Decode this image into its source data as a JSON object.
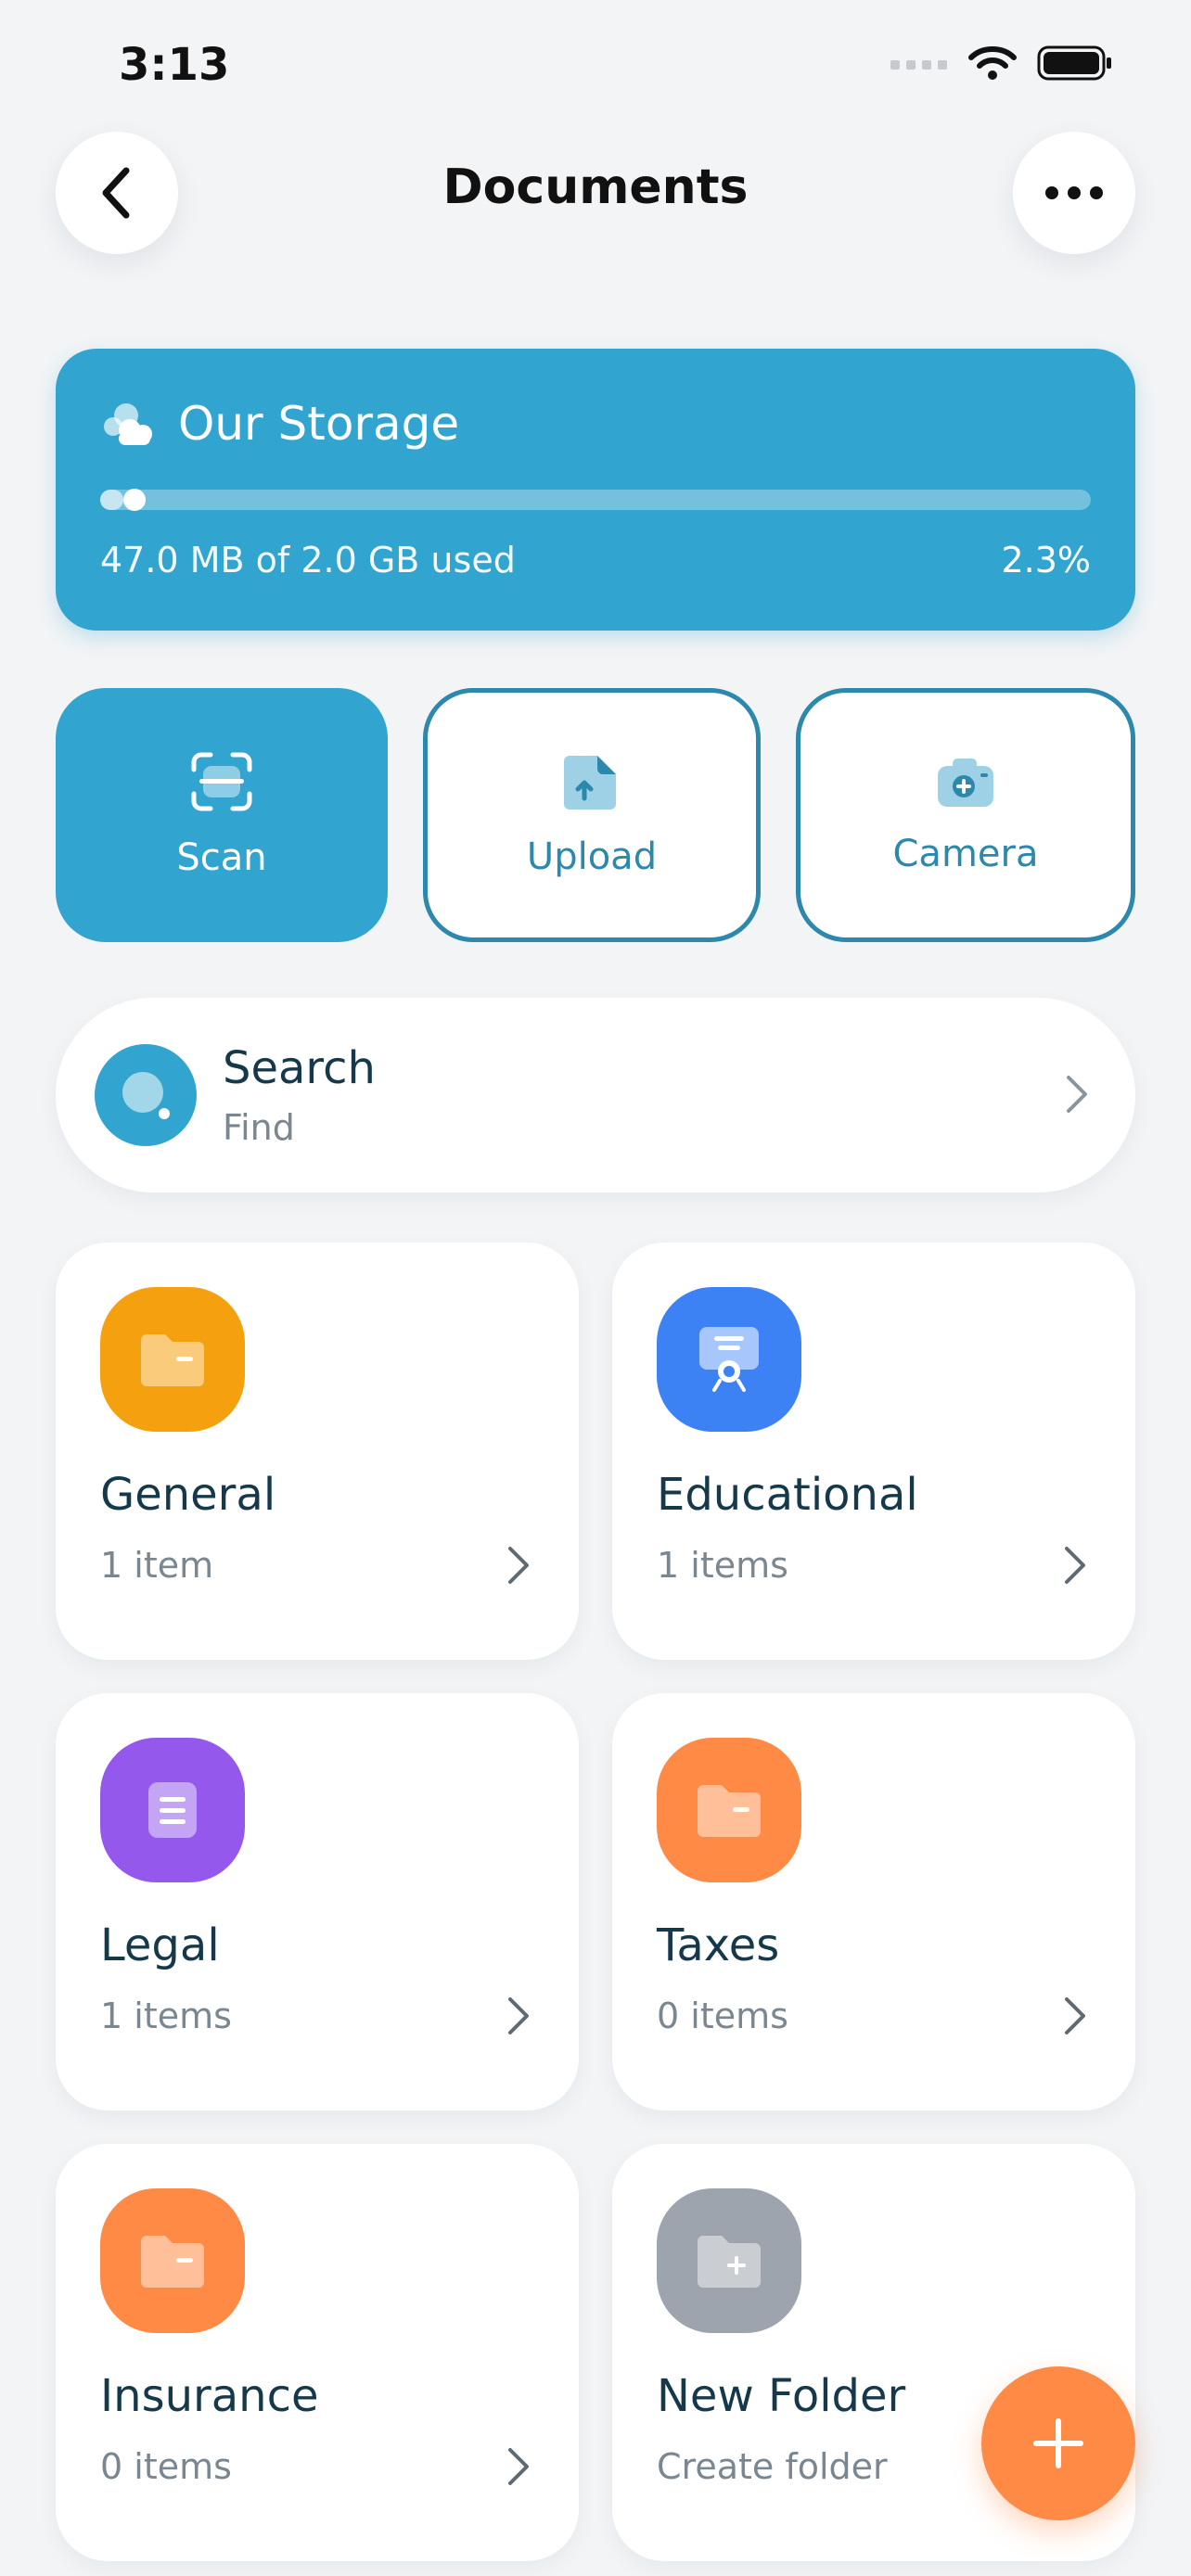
{
  "status_bar": {
    "time": "3:13"
  },
  "header": {
    "title": "Documents",
    "back_icon": "chevron-left-icon",
    "more_icon": "ellipsis-icon"
  },
  "storage": {
    "title": "Our Storage",
    "used_text": "47.0 MB of 2.0 GB used",
    "percent_text": "2.3%",
    "percent_value": 0.023,
    "color": "#31a4cf"
  },
  "actions": [
    {
      "label": "Scan",
      "icon": "scan-icon"
    },
    {
      "label": "Upload",
      "icon": "upload-file-icon"
    },
    {
      "label": "Camera",
      "icon": "camera-add-icon"
    }
  ],
  "search": {
    "title": "Search",
    "subtitle": "Find"
  },
  "folders": [
    {
      "name": "General",
      "count": "1 item",
      "icon": "folder-icon",
      "color": "#f5a00f"
    },
    {
      "name": "Educational",
      "count": "1 items",
      "icon": "certificate-icon",
      "color": "#3d82f5"
    },
    {
      "name": "Legal",
      "count": "1 items",
      "icon": "document-icon",
      "color": "#9459ec"
    },
    {
      "name": "Taxes",
      "count": "0 items",
      "icon": "folder-icon",
      "color": "#ff8a45"
    },
    {
      "name": "Insurance",
      "count": "0 items",
      "icon": "folder-icon",
      "color": "#ff8a45"
    },
    {
      "name": "New Folder",
      "count": "Create folder",
      "icon": "folder-plus-icon",
      "color": "#9ea4ad"
    }
  ],
  "fab": {
    "icon": "plus-icon",
    "color": "#ff8a45"
  }
}
